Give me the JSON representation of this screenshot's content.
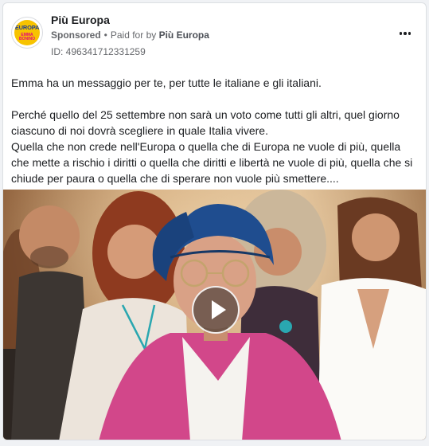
{
  "ad": {
    "page_name": "Più Europa",
    "sponsored_label": "Sponsored",
    "separator": "•",
    "paid_for_prefix": "Paid for by",
    "payer": "Più Europa",
    "library_id": "ID: 496341712331259",
    "logo": {
      "top_text": "EUROPA",
      "bottom_text_1": "EMMA",
      "bottom_text_2": "BONINO"
    },
    "icons": {
      "more": "more-horizontal-icon",
      "play": "play-icon"
    }
  },
  "body": {
    "line1": "Emma ha un messaggio per te, per tutte le italiane e gli italiani.",
    "paragraph2": "Perché quello del 25 settembre non sarà un voto come tutti gli altri, quel giorno ciascuno di noi dovrà scegliere in quale Italia vivere.",
    "paragraph3": "Quella che non crede nell'Europa o quella che di Europa ne vuole di più, quella che mette a rischio i diritti o quella che diritti e libertà ne vuole di più, quella che si chiude per paura o quella che di sperare non vuole più smettere...."
  },
  "colors": {
    "text": "#1c1e21",
    "muted": "#65676b",
    "logo_yellow": "#f7c300",
    "logo_blue": "#1c3e94",
    "logo_pink": "#e4007c"
  }
}
